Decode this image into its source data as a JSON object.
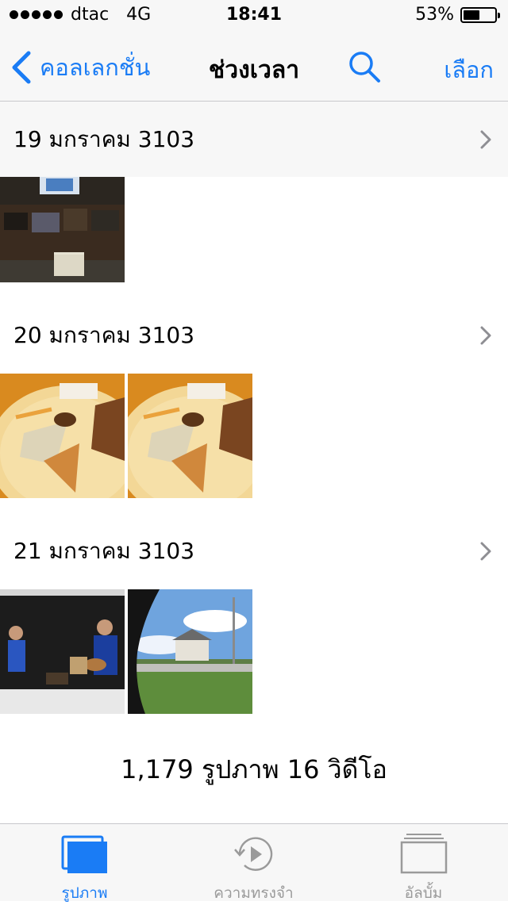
{
  "status": {
    "carrier": "dtac",
    "network": "4G",
    "time": "18:41",
    "battery_text": "53%",
    "battery_level": 0.53
  },
  "nav": {
    "back_label": "คอลเลกชั่น",
    "title": "ช่วงเวลา",
    "select_label": "เลือก",
    "search_icon": "search-icon"
  },
  "sections": [
    {
      "date": "19 มกราคม 3103",
      "photo_count": 1
    },
    {
      "date": "20 มกราคม 3103",
      "photo_count": 2
    },
    {
      "date": "21 มกราคม 3103",
      "photo_count": 2
    }
  ],
  "footer": {
    "summary": "1,179 รูปภาพ 16 วิดีโอ"
  },
  "tabs": [
    {
      "label": "รูปภาพ",
      "icon": "photos-icon",
      "active": true
    },
    {
      "label": "ความทรงจำ",
      "icon": "memories-icon",
      "active": false
    },
    {
      "label": "อัลบั้ม",
      "icon": "albums-icon",
      "active": false
    }
  ],
  "colors": {
    "accent": "#1a7cf5",
    "bar_bg": "#f7f7f7",
    "inactive": "#9a9a9a"
  }
}
